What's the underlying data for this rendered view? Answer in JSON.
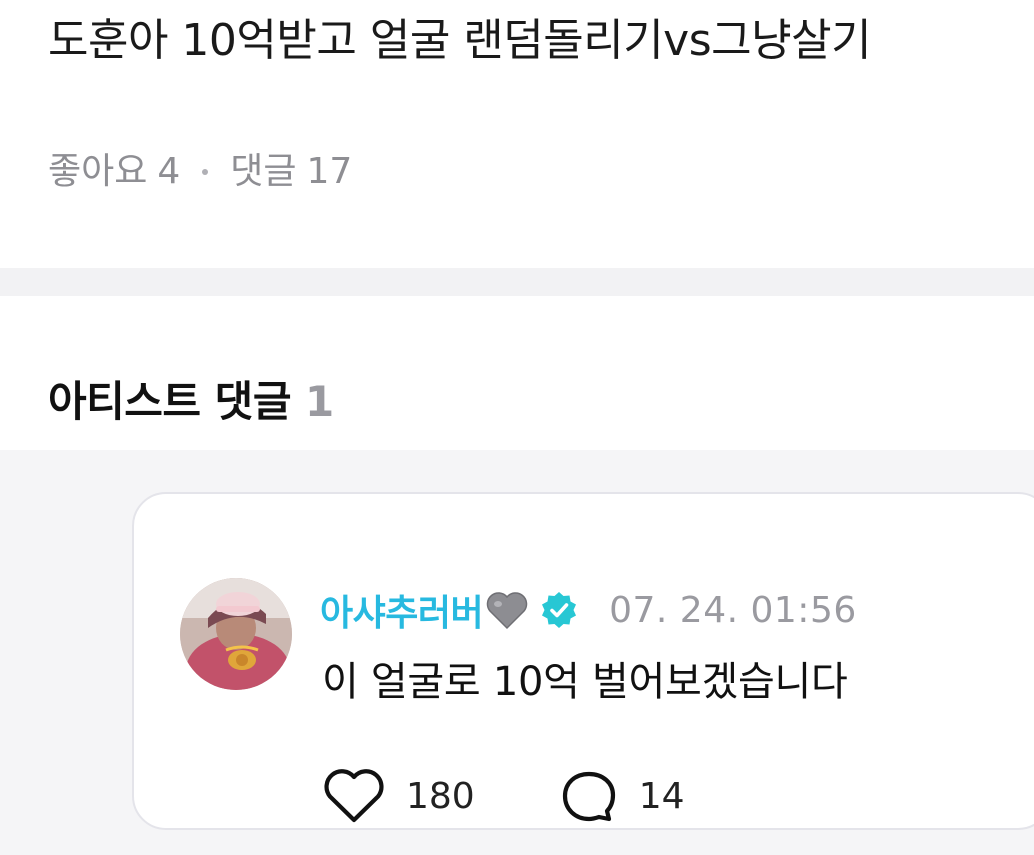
{
  "post": {
    "title": "도훈아 10억받고 얼굴 랜덤돌리기vs그냥살기",
    "likes_label": "좋아요",
    "likes_count": "4",
    "comments_label": "댓글",
    "comments_count": "17"
  },
  "artist_comments": {
    "title": "아티스트 댓글",
    "count": "1",
    "items": [
      {
        "author": "아샤추러버",
        "author_emoji": "grey-heart-emoji",
        "verified_icon": "verified-badge-icon",
        "timestamp": "07. 24. 01:56",
        "text": "이 얼굴로 10억 벌어보겠습니다",
        "like_count": "180",
        "reply_count": "14"
      }
    ]
  },
  "colors": {
    "author_accent": "#27b9e0",
    "meta_gray": "#8e8e93",
    "divider": "#f2f2f4",
    "comment_bg": "#f5f5f7"
  },
  "icons": {
    "like": "heart-outline-icon",
    "reply": "speech-bubble-icon"
  }
}
